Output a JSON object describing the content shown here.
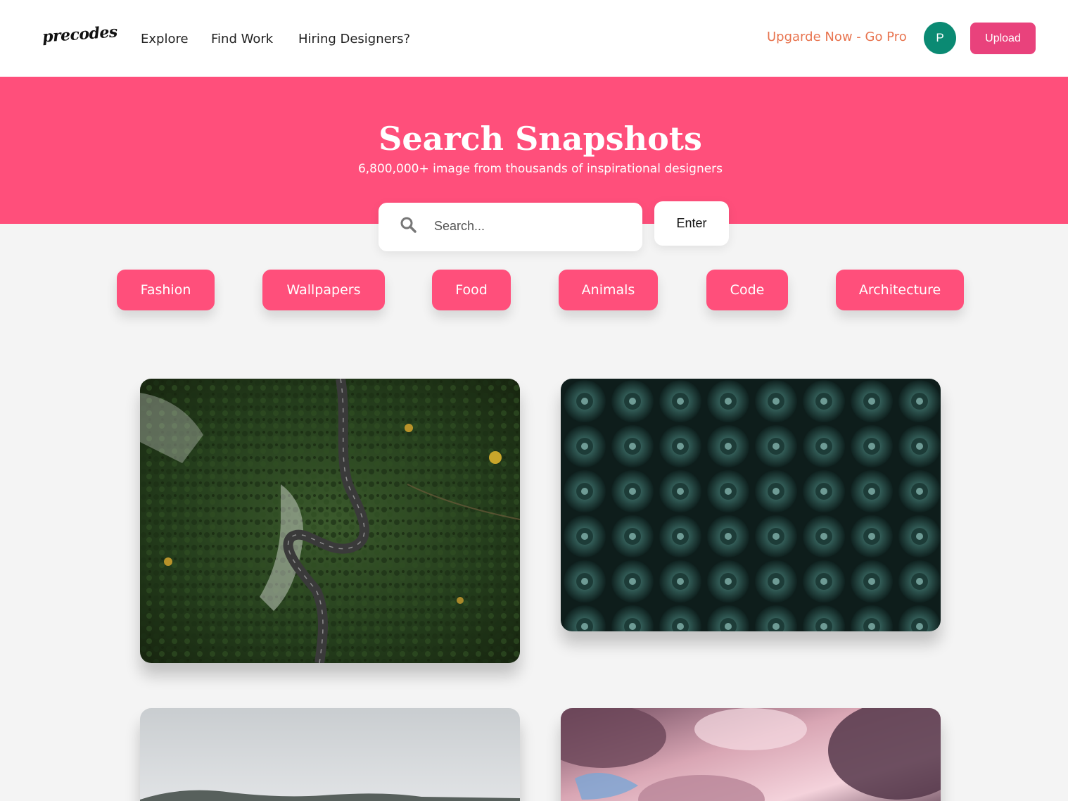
{
  "header": {
    "logo": "precodes",
    "nav": [
      "Explore",
      "Find Work",
      "Hiring Designers?"
    ],
    "pro_link": "Upgarde Now - Go Pro",
    "avatar_initial": "P",
    "upload_label": "Upload"
  },
  "hero": {
    "title": "Search Snapshots",
    "subtitle": "6,800,000+ image from thousands of inspirational designers"
  },
  "search": {
    "placeholder": "Search...",
    "value": "",
    "enter_label": "Enter"
  },
  "categories": [
    "Fashion",
    "Wallpapers",
    "Food",
    "Animals",
    "Code",
    "Architecture"
  ],
  "gallery": [
    {
      "subject": "aerial forest winding road"
    },
    {
      "subject": "dark green succulents"
    },
    {
      "subject": "misty hills"
    },
    {
      "subject": "pink clouds sky"
    }
  ],
  "colors": {
    "accent_pink": "#ff4f7b",
    "upload_pink": "#e9427c",
    "pro_orange": "#e8744f",
    "avatar_green": "#0b8a73",
    "page_bg": "#f4f4f4"
  }
}
